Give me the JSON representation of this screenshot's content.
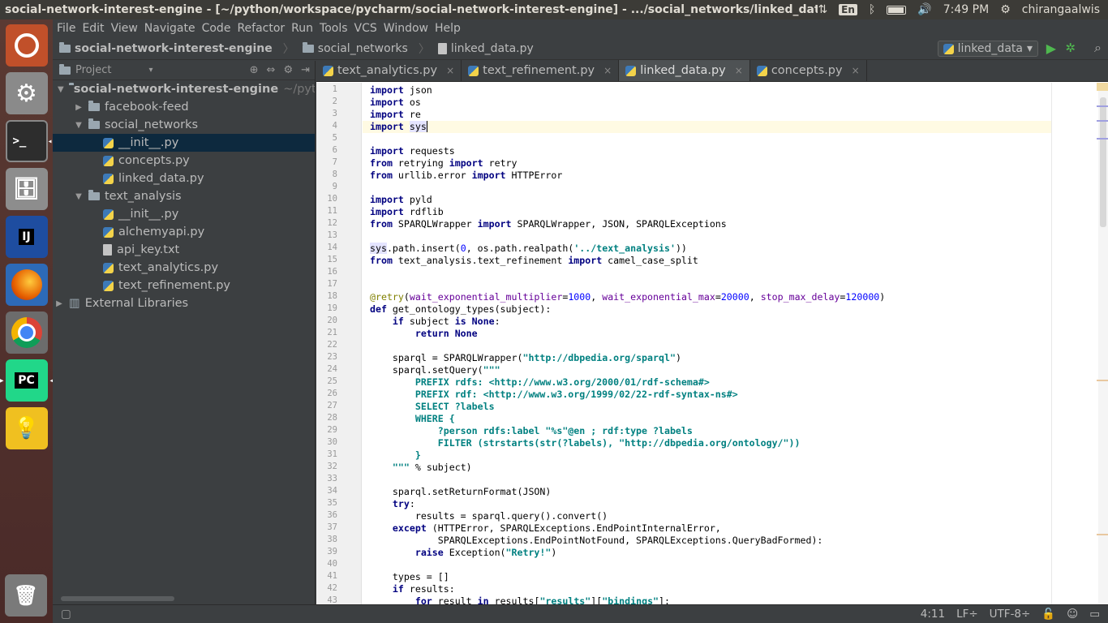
{
  "topbar": {
    "title": "social-network-interest-engine - [~/python/workspace/pycharm/social-network-interest-engine] - .../social_networks/linked_data.py - PyCh",
    "lang": "En",
    "time": "7:49 PM",
    "user": "chirangaalwis"
  },
  "menu": [
    "File",
    "Edit",
    "View",
    "Navigate",
    "Code",
    "Refactor",
    "Run",
    "Tools",
    "VCS",
    "Window",
    "Help"
  ],
  "breadcrumb": [
    "social-network-interest-engine",
    "social_networks",
    "linked_data.py"
  ],
  "run_config": "linked_data",
  "project": {
    "header": "Project",
    "root": "social-network-interest-engine",
    "root_path": "~/pytho",
    "items": [
      {
        "label": "facebook-feed",
        "type": "folder",
        "level": 1,
        "arrow": "▶"
      },
      {
        "label": "social_networks",
        "type": "folder",
        "level": 1,
        "arrow": "▼"
      },
      {
        "label": "__init__.py",
        "type": "py",
        "level": 2,
        "selected": true
      },
      {
        "label": "concepts.py",
        "type": "py",
        "level": 2
      },
      {
        "label": "linked_data.py",
        "type": "py",
        "level": 2
      },
      {
        "label": "text_analysis",
        "type": "folder",
        "level": 1,
        "arrow": "▼"
      },
      {
        "label": "__init__.py",
        "type": "py",
        "level": 2
      },
      {
        "label": "alchemyapi.py",
        "type": "py",
        "level": 2
      },
      {
        "label": "api_key.txt",
        "type": "txt",
        "level": 2
      },
      {
        "label": "text_analytics.py",
        "type": "py",
        "level": 2
      },
      {
        "label": "text_refinement.py",
        "type": "py",
        "level": 2
      }
    ],
    "external": "External Libraries"
  },
  "tabs": [
    {
      "label": "text_analytics.py",
      "active": false
    },
    {
      "label": "text_refinement.py",
      "active": false
    },
    {
      "label": "linked_data.py",
      "active": true
    },
    {
      "label": "concepts.py",
      "active": false
    }
  ],
  "code_lines": [
    "<span class='kw'>import</span> json",
    "<span class='kw'>import</span> os",
    "<span class='kw'>import</span> re",
    "<span class='kw'>import</span> <span class='hl'>sys</span><span class='cursor'></span>",
    "",
    "<span class='kw'>import</span> requests",
    "<span class='kw'>from</span> retrying <span class='kw'>import</span> retry",
    "<span class='kw'>from</span> urllib.error <span class='kw'>import</span> HTTPError",
    "",
    "<span class='kw'>import</span> pyld",
    "<span class='kw'>import</span> rdflib",
    "<span class='kw'>from</span> SPARQLWrapper <span class='kw'>import</span> SPARQLWrapper, JSON, SPARQLExceptions",
    "",
    "<span class='hl'>sys</span>.path.insert(<span class='num'>0</span>, os.path.realpath(<span class='st'>'../text_analysis'</span>))",
    "<span class='kw'>from</span> text_analysis.text_refinement <span class='kw'>import</span> camel_case_split",
    "",
    "",
    "<span class='dec'>@retry</span>(<span class='prm'>wait_exponential_multiplier</span>=<span class='num'>1000</span>, <span class='prm'>wait_exponential_max</span>=<span class='num'>20000</span>, <span class='prm'>stop_max_delay</span>=<span class='num'>120000</span>)",
    "<span class='kw'>def</span> get_ontology_types(subject):",
    "    <span class='kw'>if</span> subject <span class='kw'>is None</span>:",
    "        <span class='kw'>return None</span>",
    "",
    "    sparql = SPARQLWrapper(<span class='st'>\"http://dbpedia.org/sparql\"</span>)",
    "    sparql.setQuery(<span class='st'>\"\"\"</span>",
    "<span class='st'>        PREFIX rdfs: &lt;http://www.w3.org/2000/01/rdf-schema#&gt;</span>",
    "<span class='st'>        PREFIX rdf: &lt;http://www.w3.org/1999/02/22-rdf-syntax-ns#&gt;</span>",
    "<span class='st'>        SELECT ?labels</span>",
    "<span class='st'>        WHERE {</span>",
    "<span class='st'>            ?person rdfs:label \"%s\"@en ; rdf:type ?labels</span>",
    "<span class='st'>            FILTER (strstarts(str(?labels), \"http://dbpedia.org/ontology/\"))</span>",
    "<span class='st'>        }</span>",
    "<span class='st'>    \"\"\"</span> % subject)",
    "",
    "    sparql.setReturnFormat(JSON)",
    "    <span class='kw'>try</span>:",
    "        results = sparql.query().convert()",
    "    <span class='kw'>except</span> (HTTPError, SPARQLExceptions.EndPointInternalError,",
    "            SPARQLExceptions.EndPointNotFound, SPARQLExceptions.QueryBadFormed):",
    "        <span class='kw'>raise</span> Exception(<span class='st'>\"Retry!\"</span>)",
    "",
    "    types = []",
    "    <span class='kw'>if</span> results:",
    "        <span class='kw'>for</span> result <span class='kw'>in</span> results[<span class='st'>\"results\"</span>][<span class='st'>\"bindings\"</span>]:"
  ],
  "status": {
    "position": "4:11",
    "line_sep": "LF÷",
    "encoding": "UTF-8÷"
  }
}
